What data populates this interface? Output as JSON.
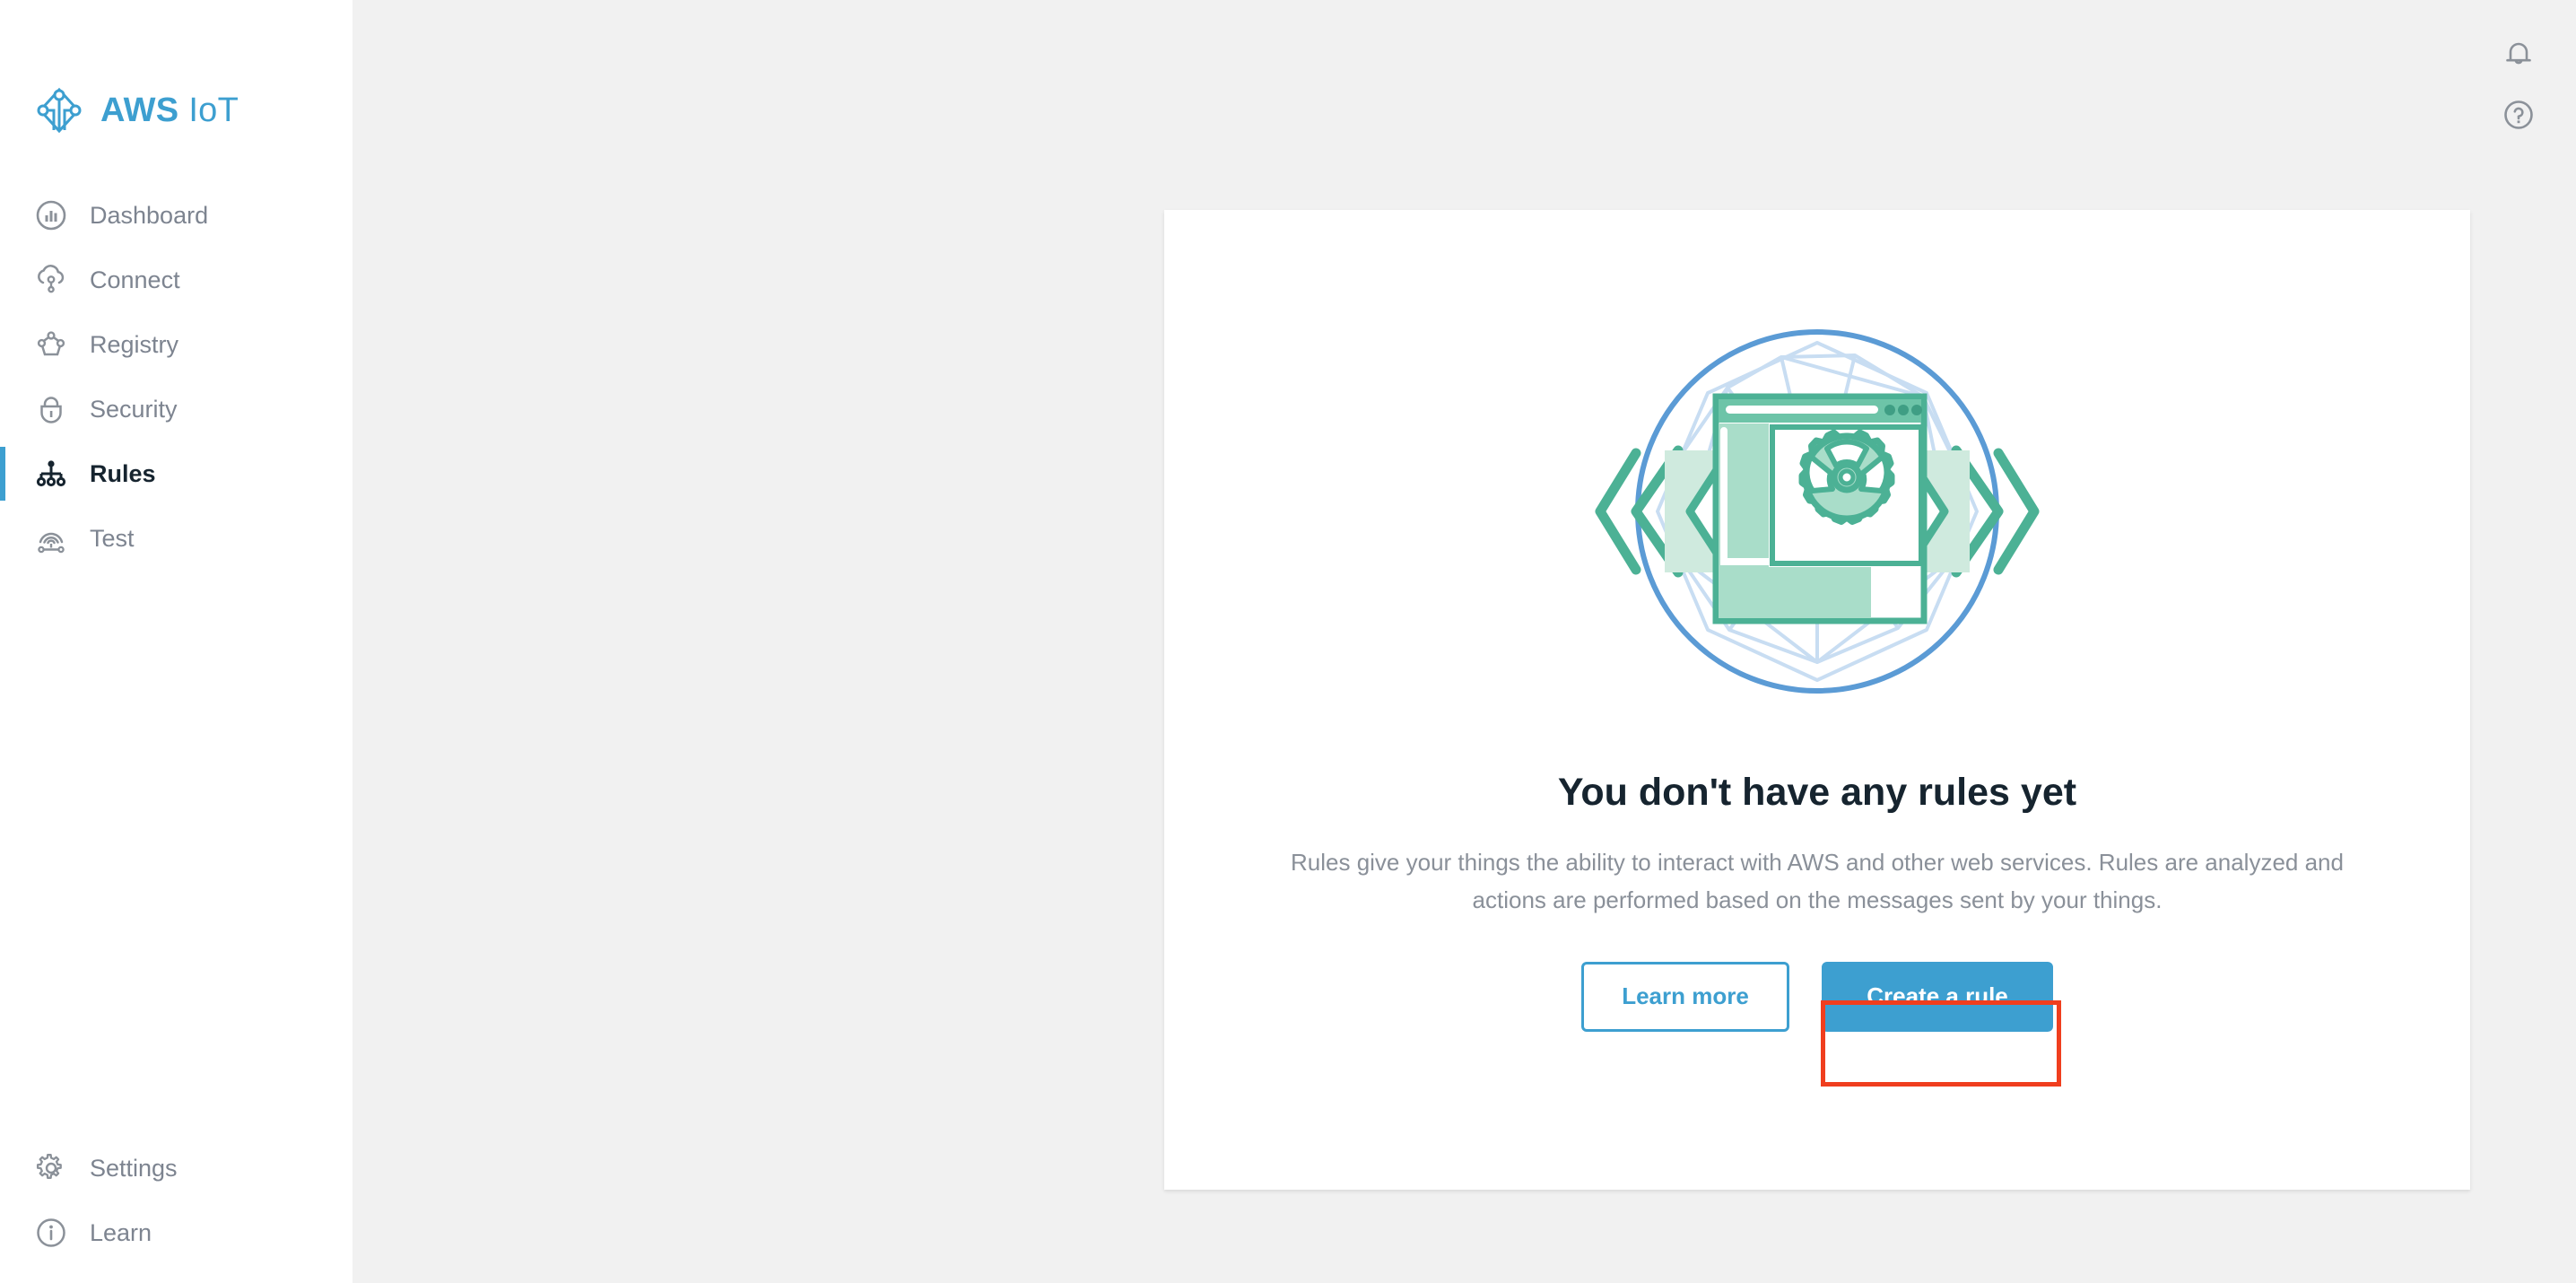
{
  "brand": {
    "name_bold": "AWS",
    "name_light": "IoT",
    "logo_icon": "aws-iot-network-logo",
    "color": "#3d9fd0"
  },
  "sidebar": {
    "main_items": [
      {
        "label": "Dashboard",
        "icon": "dashboard-chart-circle-icon",
        "active": false
      },
      {
        "label": "Connect",
        "icon": "cloud-connect-icon",
        "active": false
      },
      {
        "label": "Registry",
        "icon": "registry-nodes-icon",
        "active": false
      },
      {
        "label": "Security",
        "icon": "lock-shield-icon",
        "active": false
      },
      {
        "label": "Rules",
        "icon": "rules-hierarchy-icon",
        "active": true
      },
      {
        "label": "Test",
        "icon": "test-signal-icon",
        "active": false
      }
    ],
    "bottom_items": [
      {
        "label": "Settings",
        "icon": "gear-icon",
        "active": false
      },
      {
        "label": "Learn",
        "icon": "info-circle-icon",
        "active": false
      }
    ],
    "active_indicator_color": "#3d9fd0",
    "active_label_color": "#16242f",
    "label_color": "#7d8490"
  },
  "topbar": {
    "icons": [
      {
        "name": "notifications-bell-icon",
        "glyph": "bell"
      },
      {
        "name": "help-question-icon",
        "glyph": "question"
      }
    ]
  },
  "main": {
    "illustration": {
      "name": "rules-empty-state-illustration",
      "description": "browser window with gear surrounded by chevrons inside a polygonal circle",
      "colors": {
        "green_stroke": "#4cb195",
        "green_fill": "#a9ddc9",
        "green_fill_light": "#cfeade",
        "blue_circle": "#5b9bd5",
        "blue_polygon": "#c8ddf2"
      }
    },
    "empty_state": {
      "title": "You don't have any rules yet",
      "description": "Rules give your things the ability to interact with AWS and other web services. Rules are analyzed and actions are performed based on the messages sent by your things.",
      "title_color": "#16242f",
      "description_color": "#8a9099"
    },
    "buttons": {
      "secondary_label": "Learn more",
      "primary_label": "Create a rule",
      "accent_color": "#3d9fd0"
    }
  },
  "annotation": {
    "target": "Create a rule",
    "border_color": "#f03e1e"
  },
  "theme": {
    "page_background": "#f1f1f1",
    "card_background": "#ffffff",
    "sidebar_background": "#ffffff"
  }
}
